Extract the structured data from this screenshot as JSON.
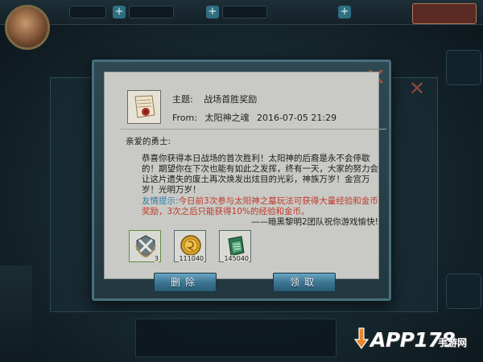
{
  "mail": {
    "subject_label": "主题:",
    "subject": "战场首胜奖励",
    "from_label": "From:",
    "sender": "太阳神之魂",
    "date": "2016-07-05 21:29",
    "greeting": "亲爱的勇士:",
    "body": "恭喜你获得本日战场的首次胜利！太阳神的后裔是永不会停歇的！期望你在下次也能有如此之发挥，终有一天，大家的努力会让这片遗失的废土再次焕发出炫目的光彩，神族万岁！金宫万岁！光明万岁！",
    "tip_label": "友情提示:",
    "tip_text": "今日前3次参与太阳神之墓玩法可获得大量经验和金币奖励，3次之后只能获得10%的经验和金币。",
    "signature": "——暗黑黎明2团队祝你游戏愉快!"
  },
  "attachments": [
    {
      "icon": "crossed-swords-badge-icon",
      "count": "3"
    },
    {
      "icon": "gold-coin-icon",
      "count": "111040"
    },
    {
      "icon": "experience-book-icon",
      "count": "145040"
    }
  ],
  "buttons": {
    "delete": "删除",
    "claim": "领取"
  },
  "watermark": {
    "brand": "APP178",
    "sub": "手游网"
  },
  "colors": {
    "tip_label": "#2f7fa6",
    "tip_text": "#c0392b",
    "button": "#3d7592",
    "close": "#b34e36"
  }
}
